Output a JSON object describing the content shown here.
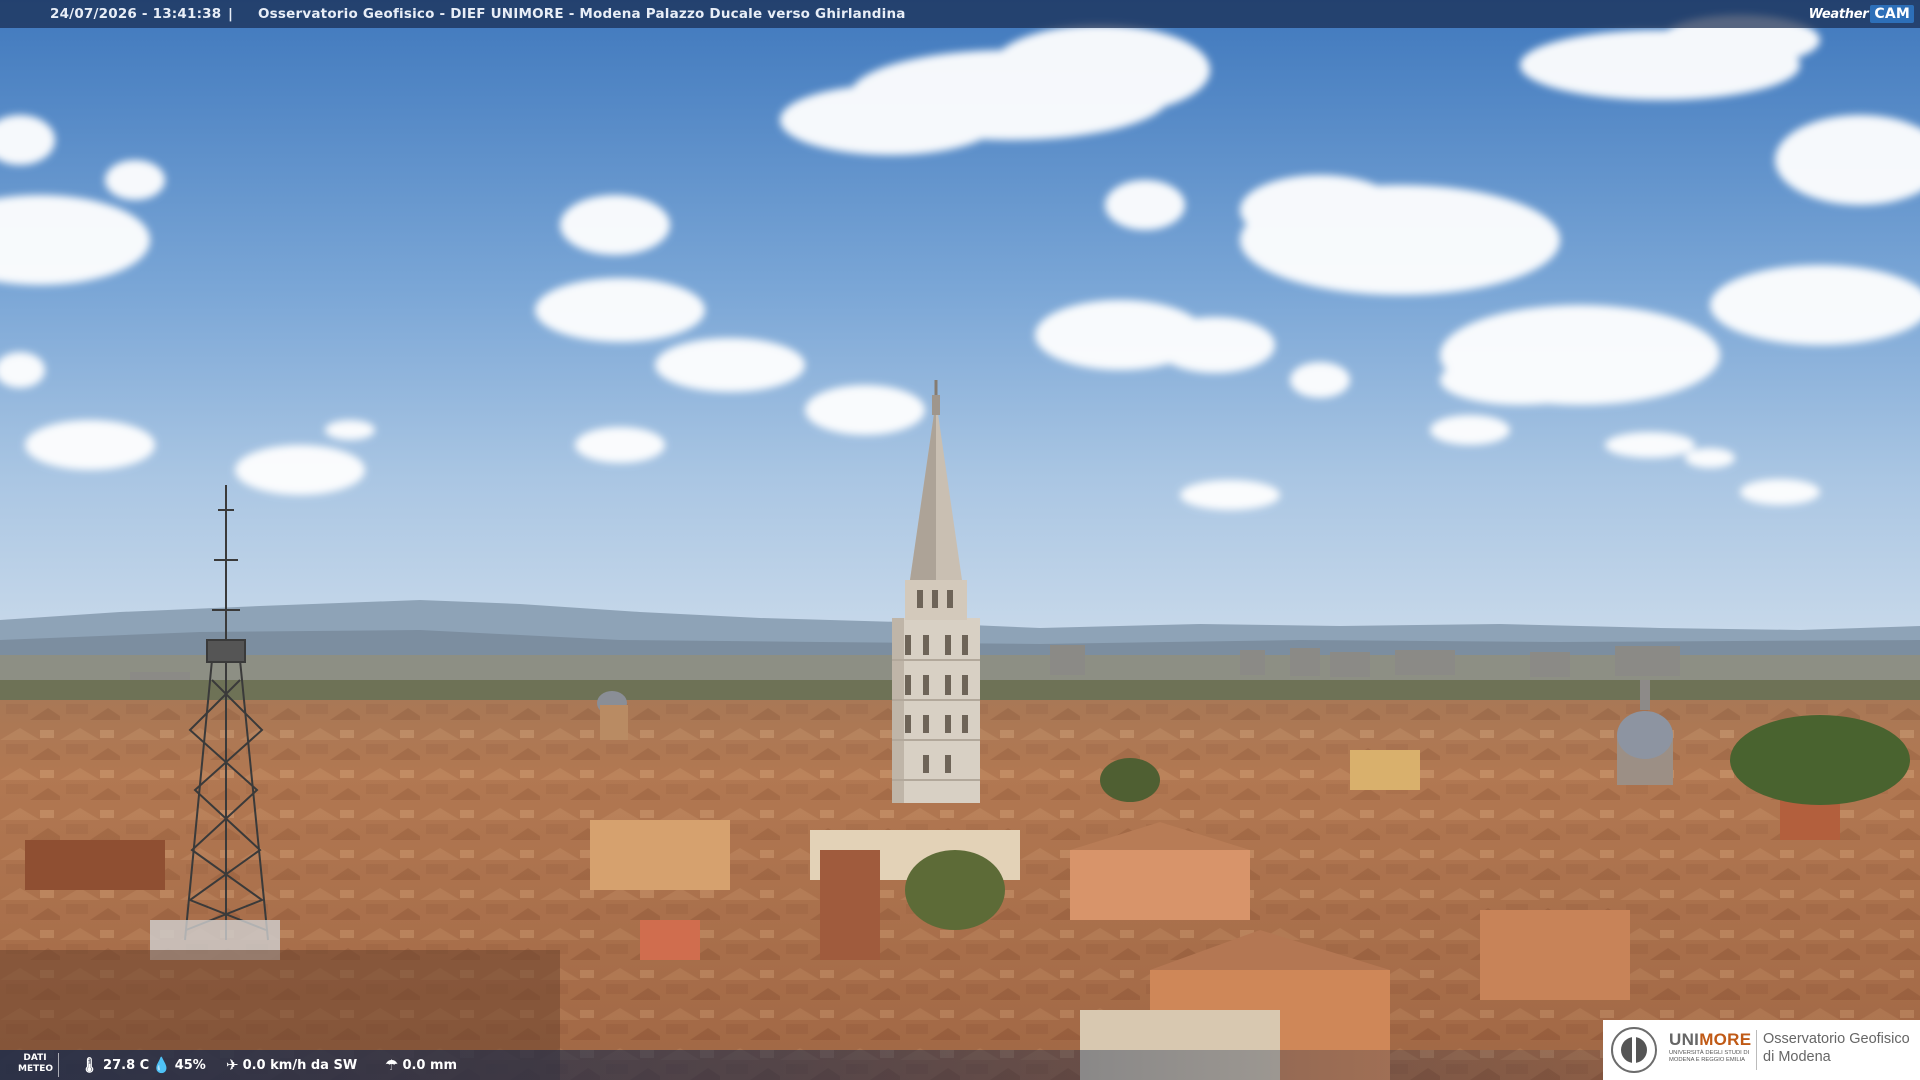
{
  "header": {
    "datetime": "24/07/2026 - 13:41:38",
    "separator": "|",
    "title": "Osservatorio Geofisico - DIEF UNIMORE - Modena Palazzo Ducale verso Ghirlandina"
  },
  "brand": {
    "weather": "Weather",
    "cam": "CAM"
  },
  "weather_bar": {
    "label_line1": "DATI",
    "label_line2": "METEO",
    "temperature": "27.8 C",
    "humidity": "45%",
    "wind": "0.0 km/h da SW",
    "rain": "0.0 mm",
    "icons": [
      "thermometer-icon",
      "humidity-drop-icon",
      "wind-icon",
      "rain-umbrella-icon"
    ]
  },
  "logo": {
    "unimore_a": "UNI",
    "unimore_b": "MORE",
    "university_sub": "UNIVERSITÀ DEGLI STUDI DI MODENA E REGGIO EMILIA",
    "observatory_line1": "Osservatorio Geofisico",
    "observatory_line2": "di Modena"
  },
  "colors": {
    "sky_top": "#4f86c6",
    "sky_horizon": "#bcd3e8",
    "roof": "#b97a52",
    "header_bar": "#1d3557",
    "unimore_orange": "#c05a16"
  }
}
